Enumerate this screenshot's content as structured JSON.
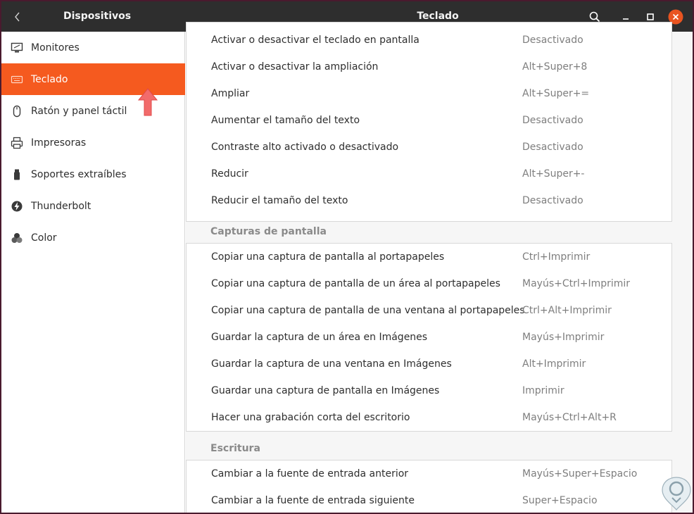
{
  "titlebar": {
    "left_title": "Dispositivos",
    "center_title": "Teclado",
    "icons": [
      "back-chevron-icon",
      "search-icon",
      "minimize-icon",
      "maximize-icon",
      "close-icon"
    ],
    "close_color": "#e95420"
  },
  "sidebar": {
    "accent": "#f55a1f",
    "items": [
      {
        "label": "Monitores",
        "icon": "monitor-icon"
      },
      {
        "label": "Teclado",
        "icon": "keyboard-icon",
        "active": true
      },
      {
        "label": "Ratón y panel táctil",
        "icon": "mouse-icon"
      },
      {
        "label": "Impresoras",
        "icon": "printer-icon"
      },
      {
        "label": "Soportes extraíbles",
        "icon": "media-icon"
      },
      {
        "label": "Thunderbolt",
        "icon": "thunderbolt-icon"
      },
      {
        "label": "Color",
        "icon": "color-icon"
      }
    ]
  },
  "accessibility": {
    "rows": [
      {
        "label": "Activar o desactivar el teclado en pantalla",
        "accel": "Desactivado"
      },
      {
        "label": "Activar o desactivar la ampliación",
        "accel": "Alt+Super+8"
      },
      {
        "label": "Ampliar",
        "accel": "Alt+Super+="
      },
      {
        "label": "Aumentar el tamaño del texto",
        "accel": "Desactivado"
      },
      {
        "label": "Contraste alto activado o desactivado",
        "accel": "Desactivado"
      },
      {
        "label": "Reducir",
        "accel": "Alt+Super+-"
      },
      {
        "label": "Reducir el tamaño del texto",
        "accel": "Desactivado"
      }
    ]
  },
  "screenshots": {
    "header": "Capturas de pantalla",
    "rows": [
      {
        "label": "Copiar una captura de pantalla al portapapeles",
        "accel": "Ctrl+Imprimir"
      },
      {
        "label": "Copiar una captura de pantalla de un área al portapapeles",
        "accel": "Mayús+Ctrl+Imprimir"
      },
      {
        "label": "Copiar una captura de pantalla de una ventana al portapapeles",
        "accel": "Ctrl+Alt+Imprimir"
      },
      {
        "label": "Guardar la captura de un área en Imágenes",
        "accel": "Mayús+Imprimir"
      },
      {
        "label": "Guardar la captura de una ventana en Imágenes",
        "accel": "Alt+Imprimir"
      },
      {
        "label": "Guardar una captura de pantalla en Imágenes",
        "accel": "Imprimir"
      },
      {
        "label": "Hacer una grabación corta del escritorio",
        "accel": "Mayús+Ctrl+Alt+R"
      }
    ]
  },
  "typing": {
    "header": "Escritura",
    "rows": [
      {
        "label": "Cambiar a la fuente de entrada anterior",
        "accel": "Mayús+Super+Espacio"
      },
      {
        "label": "Cambiar a la fuente de entrada siguiente",
        "accel": "Super+Espacio"
      }
    ]
  },
  "annotation": {
    "icon": "red-up-arrow-icon"
  },
  "watermark": {
    "icon": "solvetic-logo-icon"
  }
}
